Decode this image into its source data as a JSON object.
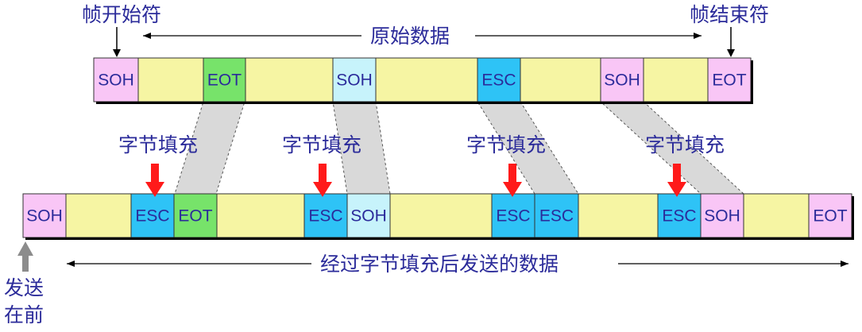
{
  "labels": {
    "frame_start": "帧开始符",
    "frame_end": "帧结束符",
    "original_data": "原始数据",
    "stuffed_data": "经过字节填充后发送的数据",
    "send_first_line1": "发送",
    "send_first_line2": "在前",
    "byte_stuffing": "字节填充"
  },
  "top_frame": {
    "cells": [
      {
        "text": "SOH",
        "color": "#f9c6f6"
      },
      {
        "text": "",
        "color": "#f6f5a3"
      },
      {
        "text": "EOT",
        "color": "#77e36a"
      },
      {
        "text": "",
        "color": "#f6f5a3"
      },
      {
        "text": "SOH",
        "color": "#c7f3fb"
      },
      {
        "text": "",
        "color": "#f6f5a3"
      },
      {
        "text": "ESC",
        "color": "#2ec3f6"
      },
      {
        "text": "",
        "color": "#f6f5a3"
      },
      {
        "text": "SOH",
        "color": "#f9c6f6"
      },
      {
        "text": "",
        "color": "#f6f5a3"
      },
      {
        "text": "EOT",
        "color": "#f9c6f6"
      }
    ]
  },
  "bottom_frame": {
    "cells": [
      {
        "text": "SOH",
        "color": "#f9c6f6"
      },
      {
        "text": "",
        "color": "#f6f5a3"
      },
      {
        "text": "ESC",
        "color": "#2ec3f6"
      },
      {
        "text": "EOT",
        "color": "#77e36a"
      },
      {
        "text": "",
        "color": "#f6f5a3"
      },
      {
        "text": "ESC",
        "color": "#2ec3f6"
      },
      {
        "text": "SOH",
        "color": "#c7f3fb"
      },
      {
        "text": "",
        "color": "#f6f5a3"
      },
      {
        "text": "ESC",
        "color": "#2ec3f6"
      },
      {
        "text": "ESC",
        "color": "#2ec3f6"
      },
      {
        "text": "",
        "color": "#f6f5a3"
      },
      {
        "text": "ESC",
        "color": "#2ec3f6"
      },
      {
        "text": "SOH",
        "color": "#f9c6f6"
      },
      {
        "text": "",
        "color": "#f6f5a3"
      },
      {
        "text": "EOT",
        "color": "#f9c6f6"
      }
    ]
  },
  "colors": {
    "label_text": "#2b2b9a",
    "cell_text": "#2b2b9a",
    "stuff_arrow": "#ff1a1a",
    "mapping_band": "#d9d9d9",
    "send_arrow": "#8c8c8c"
  }
}
